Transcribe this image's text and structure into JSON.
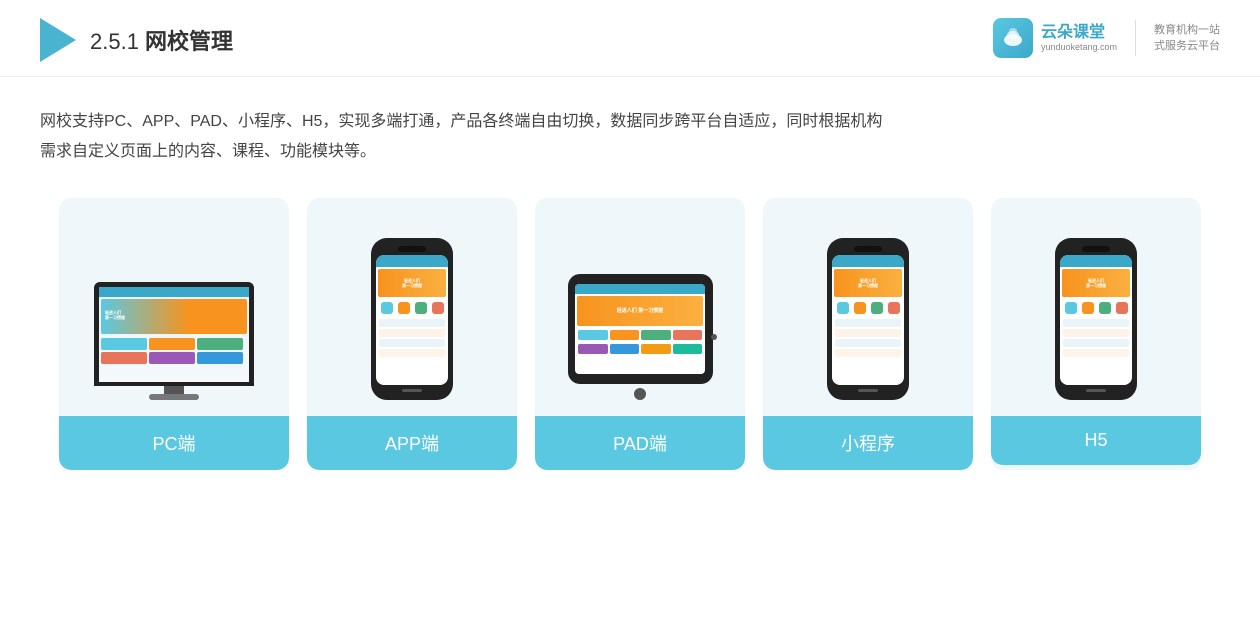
{
  "header": {
    "section_number": "2.5.1",
    "title_plain": "2.5.1 ",
    "title_bold": "网校管理",
    "brand": {
      "name": "云朵课堂",
      "url": "yunduoketang.com",
      "tagline_line1": "教育机构一站",
      "tagline_line2": "式服务云平台"
    }
  },
  "description": {
    "text_line1": "网校支持PC、APP、PAD、小程序、H5，实现多端打通，产品各终端自由切换，数据同步跨平台自适应，同时根据机构",
    "text_line2": "需求自定义页面上的内容、课程、功能模块等。"
  },
  "cards": [
    {
      "id": "pc",
      "label": "PC端",
      "type": "pc"
    },
    {
      "id": "app",
      "label": "APP端",
      "type": "phone"
    },
    {
      "id": "pad",
      "label": "PAD端",
      "type": "tablet"
    },
    {
      "id": "miniprogram",
      "label": "小程序",
      "type": "phone"
    },
    {
      "id": "h5",
      "label": "H5",
      "type": "phone"
    }
  ],
  "colors": {
    "teal": "#5bc8e2",
    "dark_teal": "#3aa8c8",
    "orange": "#f7931e",
    "bg_card": "#f0f7fb",
    "dark": "#222222"
  }
}
